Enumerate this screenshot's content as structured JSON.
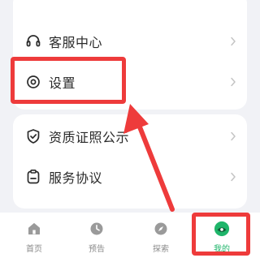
{
  "menu": {
    "items": [
      {
        "label": "客服中心",
        "icon": "headset-icon"
      },
      {
        "label": "设置",
        "icon": "settings-icon"
      },
      {
        "label": "资质证照公示",
        "icon": "shield-check-icon"
      },
      {
        "label": "服务协议",
        "icon": "clipboard-icon"
      }
    ]
  },
  "tabbar": {
    "tabs": [
      {
        "label": "首页",
        "icon": "home-icon",
        "active": false
      },
      {
        "label": "预告",
        "icon": "clock-icon",
        "active": false
      },
      {
        "label": "探索",
        "icon": "compass-icon",
        "active": false
      },
      {
        "label": "我的",
        "icon": "profile-icon",
        "active": true
      }
    ]
  },
  "colors": {
    "highlight": "#ee3b3b",
    "accent_green": "#1fb56a"
  }
}
